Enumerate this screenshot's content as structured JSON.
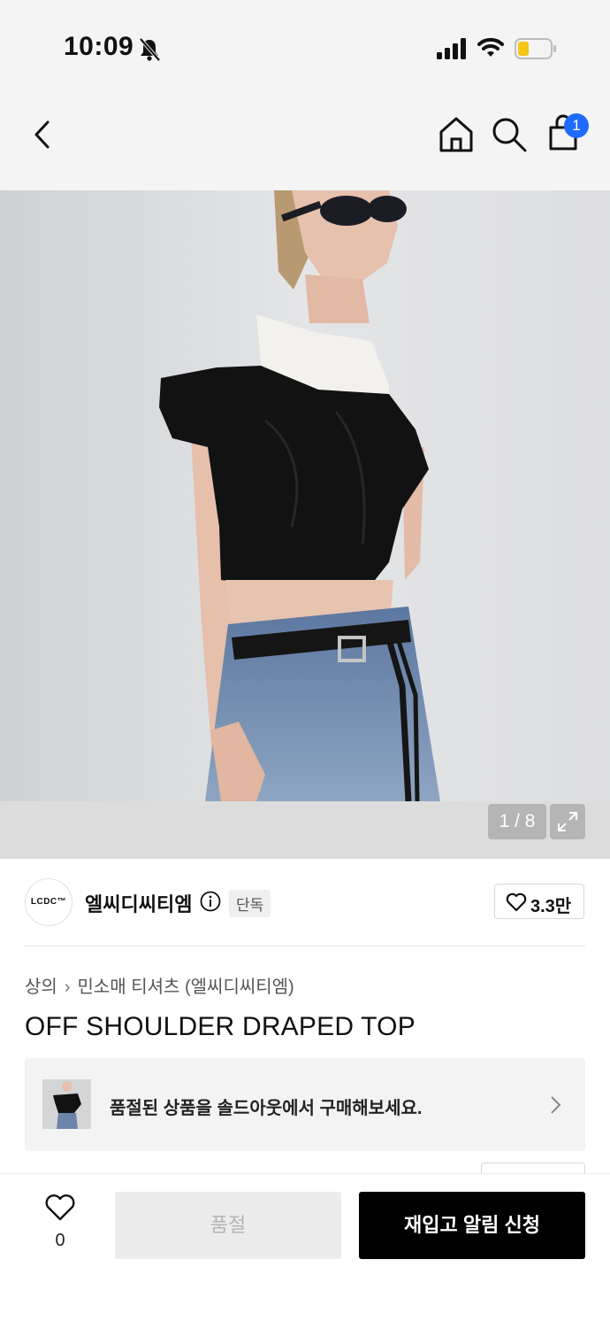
{
  "status_bar": {
    "time": "10:09"
  },
  "nav": {
    "cart_count": "1"
  },
  "gallery": {
    "counter": "1 / 8"
  },
  "brand": {
    "logo_text": "LCDC™",
    "name": "엘씨디씨티엠",
    "exclusive_label": "단독",
    "like_count": "3.3만"
  },
  "breadcrumb": {
    "level1": "상의",
    "level2": "민소매 티셔츠 (엘씨디씨티엠)"
  },
  "product": {
    "title": "OFF SHOULDER DRAPED TOP"
  },
  "soldout_banner": {
    "text": "품절된 상품을 솔드아웃에서 구매해보세요."
  },
  "bottom_bar": {
    "wish_count": "0",
    "soldout_label": "품절",
    "restock_label": "재입고 알림 신청"
  },
  "colors": {
    "accent_badge": "#1f6bff",
    "primary_button": "#000000",
    "disabled_button": "#ececec"
  }
}
